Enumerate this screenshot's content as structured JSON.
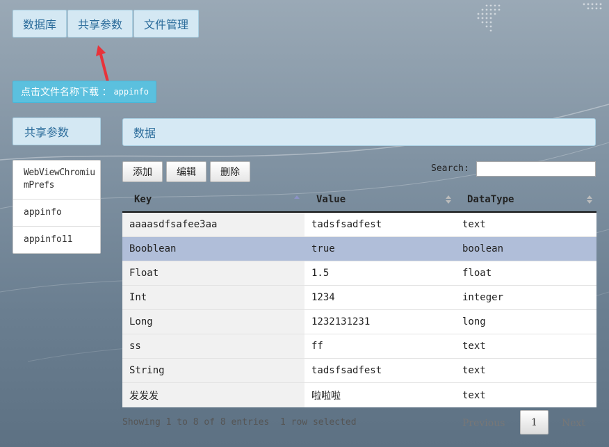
{
  "top_nav": {
    "items": [
      "数据库",
      "共享参数",
      "文件管理"
    ],
    "active_index": 1
  },
  "download": {
    "label": "点击文件名称下载 ：",
    "file": "appinfo"
  },
  "sidebar": {
    "header": "共享参数",
    "items": [
      "WebViewChromiumPrefs",
      "appinfo",
      "appinfo11"
    ]
  },
  "main": {
    "title": "数据"
  },
  "toolbar": {
    "add": "添加",
    "edit": "编辑",
    "delete": "删除"
  },
  "search": {
    "label": "Search:",
    "value": ""
  },
  "table": {
    "columns": [
      "Key",
      "Value",
      "DataType"
    ],
    "rows": [
      {
        "key": "aaaasdfsafee3aa",
        "value": "tadsfsadfest",
        "type": "text"
      },
      {
        "key": "Booblean",
        "value": "true",
        "type": "boolean"
      },
      {
        "key": "Float",
        "value": "1.5",
        "type": "float"
      },
      {
        "key": "Int",
        "value": "1234",
        "type": "integer"
      },
      {
        "key": "Long",
        "value": "1232131231",
        "type": "long"
      },
      {
        "key": "ss",
        "value": "ff",
        "type": "text"
      },
      {
        "key": "String",
        "value": "tadsfsadfest",
        "type": "text"
      },
      {
        "key": "发发发",
        "value": "啦啦啦",
        "type": "text"
      }
    ],
    "selected_row_index": 1,
    "sorted_column_index": 0,
    "sort_direction": "ascending"
  },
  "footer": {
    "info": "Showing 1 to 8 of 8 entries",
    "selected": "1 row selected"
  },
  "pagination": {
    "previous": "Previous",
    "current_page": "1",
    "next": "Next"
  },
  "colors": {
    "nav_bg": "#d4e8f3",
    "nav_text": "#2a6b9a",
    "download_bg": "#5bc0de",
    "selected_row": "#b0bed9",
    "annotation_arrow": "#e8333a"
  },
  "icons": {
    "sort": "sort-both-icon",
    "sort_asc": "sort-asc-icon",
    "arrow": "annotation-arrow-icon"
  }
}
